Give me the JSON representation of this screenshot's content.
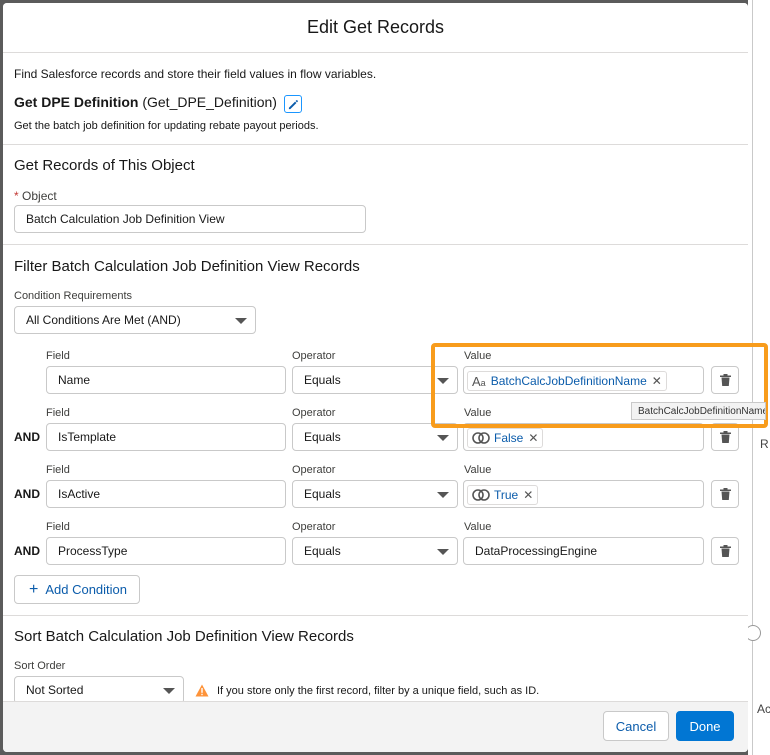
{
  "modal": {
    "title": "Edit Get Records",
    "description": "Find Salesforce records and store their field values in flow variables.",
    "element_label": "Get DPE Definition",
    "element_api_name": "(Get_DPE_Definition)",
    "element_description": "Get the batch job definition for updating rebate payout periods."
  },
  "object_section": {
    "title": "Get Records of This Object",
    "required_mark": "*",
    "object_label": "Object",
    "object_value": "Batch Calculation Job Definition View"
  },
  "filter_section": {
    "title": "Filter Batch Calculation Job Definition View Records",
    "condition_requirements_label": "Condition Requirements",
    "condition_requirements_value": "All Conditions Are Met (AND)",
    "field_label": "Field",
    "operator_label": "Operator",
    "value_label": "Value",
    "conditions": [
      {
        "connector": "",
        "field": "Name",
        "operator": "Equals",
        "value": "BatchCalcJobDefinitionName",
        "value_type": "text-icon"
      },
      {
        "connector": "AND",
        "field": "IsTemplate",
        "operator": "Equals",
        "value": "False",
        "value_type": "boolean-icon"
      },
      {
        "connector": "AND",
        "field": "IsActive",
        "operator": "Equals",
        "value": "True",
        "value_type": "boolean-icon"
      },
      {
        "connector": "AND",
        "field": "ProcessType",
        "operator": "Equals",
        "value": "DataProcessingEngine",
        "value_type": "plain"
      }
    ],
    "add_condition_label": "Add Condition",
    "tooltip": "BatchCalcJobDefinitionName"
  },
  "sort_section": {
    "title": "Sort Batch Calculation Job Definition View Records",
    "sort_order_label": "Sort Order",
    "sort_order_value": "Not Sorted",
    "warning": "If you store only the first record, filter by a unique field, such as ID."
  },
  "footer": {
    "cancel_label": "Cancel",
    "done_label": "Done"
  },
  "background": {
    "letters": [
      "R",
      "Ac"
    ]
  },
  "colors": {
    "brand": "#0176d3",
    "link": "#0b5cab",
    "highlight": "#f89c1c",
    "warning": "#fe9339",
    "required": "#c23934"
  }
}
